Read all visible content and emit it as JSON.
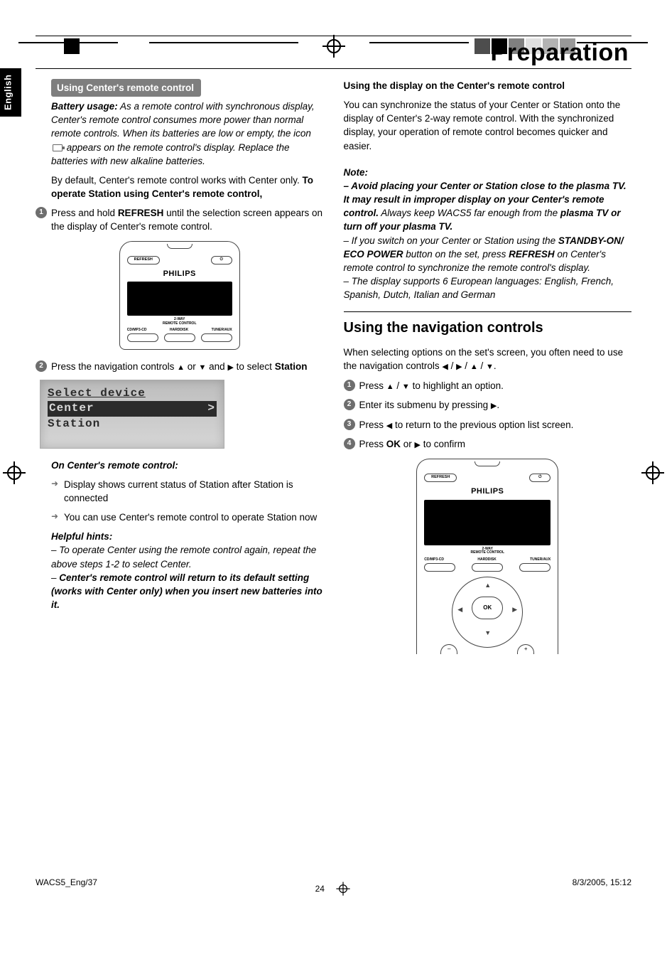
{
  "page_title": "Preparation",
  "language_tab": "English",
  "left": {
    "section_heading": "Using Center's remote control",
    "battery_label": "Battery usage:",
    "battery_text_a": " As a remote control with synchronous display, Center's remote control consumes more power than normal remote controls. When its batteries are low or empty, the icon ",
    "battery_text_b": " appears on the remote control's display. Replace the batteries with new alkaline batteries.",
    "default_text": "By default, Center's remote control works with Center only. ",
    "default_bold": "To operate Station using Center's remote control,",
    "step1_a": "Press and hold ",
    "step1_b": "REFRESH",
    "step1_c": " until the selection screen appears on the display of Center's remote control.",
    "step2_a": "Press the navigation controls ",
    "step2_b": " or ",
    "step2_c": " and ",
    "step2_d": " to select ",
    "step2_e": "Station",
    "lcd_line1": "Select device",
    "lcd_line2": "Center",
    "lcd_line3": "Station",
    "on_remote_heading": "On Center's remote control:",
    "bullet1": "Display shows current status of Station after Station is connected",
    "bullet2": "You can use Center's remote control to operate Station now",
    "hints_heading": "Helpful hints:",
    "hint1": "–  To operate Center using the remote control again, repeat the above steps 1-2 to select Center.",
    "hint2_prefix": "–  ",
    "hint2": "Center's remote control will return to its default setting (works with Center only) when you insert new batteries into it."
  },
  "right": {
    "display_heading": "Using the display on the Center's remote control",
    "display_para": "You can synchronize the status of your Center or Station onto the display of Center's 2-way remote control. With the synchronized display, your operation of remote control becomes quicker and easier.",
    "note_label": "Note:",
    "note1_a": "–  Avoid placing your Center or Station close to the plasma TV.  It may result in improper display on your Center's remote control.",
    "note1_b": " Always keep WACS5 far enough from the ",
    "note1_c": "plasma TV or turn off your plasma TV.",
    "note2_a": "–  If you switch on your Center or Station using the ",
    "note2_b": "STANDBY-ON/ ECO POWER",
    "note2_c": " button on the set,  press ",
    "note2_d": "REFRESH",
    "note2_e": " on Center's remote control to synchronize the remote control's display.",
    "note3": "–  The display supports 6 European languages: English, French, Spanish, Dutch, Italian and German",
    "nav_heading": "Using the navigation controls",
    "nav_para_a": "When selecting options on the set's screen, you often need to use the navigation controls ",
    "nav_para_b": " / ",
    "nav_para_c": " / ",
    "nav_para_d": " / ",
    "nav_para_e": ".",
    "nstep1_a": "Press  ",
    "nstep1_b": " / ",
    "nstep1_c": " to highlight an option.",
    "nstep2_a": "Enter its submenu by pressing ",
    "nstep2_b": ".",
    "nstep3_a": "Press ",
    "nstep3_b": " to return to the previous option list screen.",
    "nstep4_a": "Press ",
    "nstep4_b": "OK",
    "nstep4_c": " or ",
    "nstep4_d": " to confirm"
  },
  "remote": {
    "refresh": "REFRESH",
    "power": "⏻",
    "brand": "PHILIPS",
    "sub1": "2-WAY",
    "sub2": "REMOTE CONTROL",
    "tab1": "CD/MP3-CD",
    "tab2": "HARDDISK",
    "tab3": "TUNER/AUX",
    "ok": "OK",
    "minus": "–",
    "plus": "+"
  },
  "arrows": {
    "up": "▲",
    "down": "▼",
    "left": "◀",
    "right": "▶"
  },
  "footer": {
    "left": "WACS5_Eng/37",
    "page": "24",
    "right": "8/3/2005, 15:12"
  }
}
